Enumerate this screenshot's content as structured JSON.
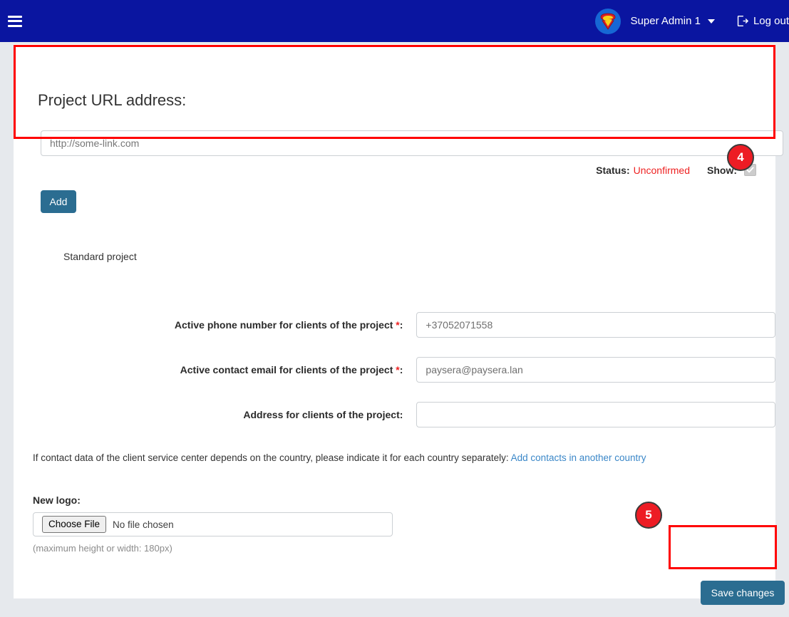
{
  "topbar": {
    "menu_icon": "hamburger-icon",
    "avatar_icon": "superman-avatar-icon",
    "user_name": "Super Admin 1",
    "logout_label": "Log out",
    "background_color": "#0a15a0"
  },
  "url_section": {
    "title": "Project URL address:",
    "url_placeholder": "http://some-link.com",
    "url_value": "",
    "status_label": "Status:",
    "status_value": "Unconfirmed",
    "status_color": "#ee2222",
    "show_label": "Show:",
    "show_checked": true,
    "add_button_label": "Add",
    "annotation_number": "4"
  },
  "form": {
    "project_type": "Standard project",
    "fields": [
      {
        "label": "Active phone number for clients of the project",
        "required": true,
        "value": "+37052071558",
        "placeholder": "+37052071558"
      },
      {
        "label": "Active contact email for clients of the project",
        "required": true,
        "value": "paysera@paysera.lan",
        "placeholder": "paysera@paysera.lan"
      },
      {
        "label": "Address for clients of the project",
        "required": false,
        "value": "",
        "placeholder": ""
      }
    ],
    "helper_text": "If contact data of the client service center depends on the country, please indicate it for each country separately:",
    "helper_link": "Add contacts in another country",
    "logo_label": "New logo:",
    "file_button_label": "Choose File",
    "file_status": "No file chosen",
    "logo_hint": "(maximum height or width: 180px)",
    "save_button_label": "Save changes",
    "annotation_number": "5"
  },
  "theme": {
    "button_color": "#2b6d91",
    "link_color": "#3a87c8",
    "annotation_color": "#ff0000",
    "page_background": "#e6e9ed"
  }
}
